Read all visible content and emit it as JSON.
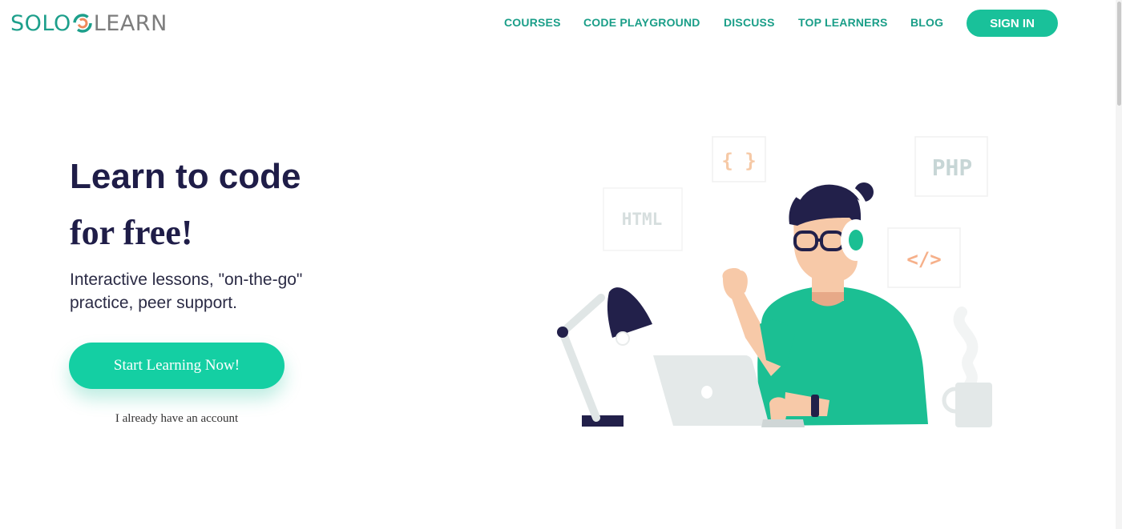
{
  "brand": {
    "logo_left": "SOLO",
    "logo_right": "LEARN",
    "primary_color": "#19c19a",
    "dark_color": "#1f1d48"
  },
  "nav": {
    "items": [
      {
        "label": "COURSES"
      },
      {
        "label": "CODE PLAYGROUND"
      },
      {
        "label": "DISCUSS"
      },
      {
        "label": "TOP LEARNERS"
      },
      {
        "label": "BLOG"
      }
    ],
    "signin_label": "SIGN IN"
  },
  "hero": {
    "headline_line1": "Learn to code",
    "headline_line2": "for free!",
    "subtitle": "Interactive lessons, \"on-the-go\" practice, peer support.",
    "cta_label": "Start Learning Now!",
    "secondary_link": "I already have an account"
  },
  "illustration": {
    "cards": [
      {
        "text": "{ }",
        "icon": "braces-icon"
      },
      {
        "text": "PHP",
        "icon": "php-card"
      },
      {
        "text": "HTML",
        "icon": "html-card"
      },
      {
        "text": "</>",
        "icon": "code-tag-icon"
      }
    ]
  }
}
